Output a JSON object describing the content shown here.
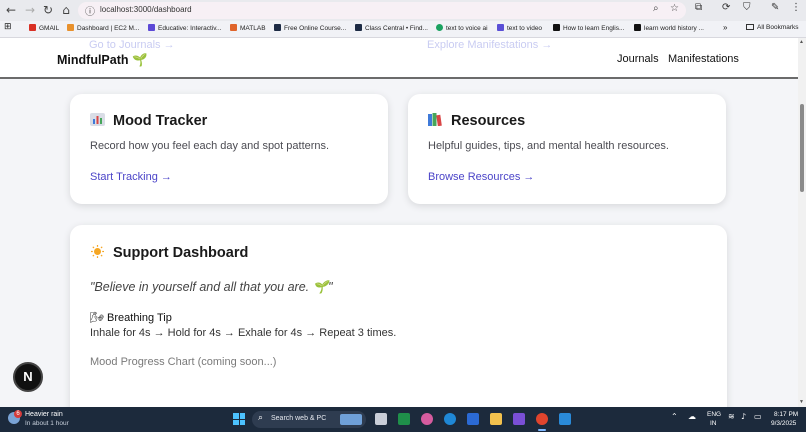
{
  "browser": {
    "url": "localhost:3000/dashboard",
    "bookmarks": [
      {
        "label": "GMAIL",
        "color": "#d93025"
      },
      {
        "label": "Dashboard | EC2 M...",
        "color": "#e8912d"
      },
      {
        "label": "Educative: Interactiv...",
        "color": "#5c49d6"
      },
      {
        "label": "MATLAB",
        "color": "#e0642a"
      },
      {
        "label": "Free Online Course...",
        "color": "#1d2b44"
      },
      {
        "label": "Class Central • Find...",
        "color": "#1d2b44"
      },
      {
        "label": "text to voice ai",
        "color": "#1aa260"
      },
      {
        "label": "text to video",
        "color": "#5a4fd6"
      },
      {
        "label": "How to learn Englis...",
        "color": "#111111"
      },
      {
        "label": "learn world history ...",
        "color": "#111111"
      }
    ],
    "all_bookmarks": "All Bookmarks"
  },
  "header": {
    "ghost_left": "Go to Journals →",
    "ghost_right": "Explore Manifestations →",
    "brand": "MindfulPath 🌱",
    "nav": [
      "Journals",
      "Manifestations"
    ]
  },
  "cards": {
    "mood": {
      "title": "Mood Tracker",
      "icon": "bar-chart-icon",
      "desc": "Record how you feel each day and spot patterns.",
      "link": "Start Tracking →"
    },
    "resources": {
      "title": "Resources",
      "icon": "books-icon",
      "desc": "Helpful guides, tips, and mental health resources.",
      "link": "Browse Resources →"
    }
  },
  "support": {
    "title": "Support Dashboard",
    "icon": "sun-icon",
    "quote": "\"Believe in yourself and all that you are. 🌱\"",
    "tip_title": "🌬 Breathing Tip",
    "tip_text": "Inhale for 4s → Hold for 4s → Exhale for 4s → Repeat 3 times.",
    "chart_note": "Mood Progress Chart (coming soon...)"
  },
  "dev_badge": "N",
  "taskbar": {
    "weather_title": "Heavier rain",
    "weather_sub": "In about 1 hour",
    "weather_badge": "6",
    "search": "Search web & PC",
    "lang_1": "ENG",
    "lang_2": "IN",
    "time": "8:17 PM",
    "date": "9/3/2025"
  },
  "colors": {
    "accent_link": "#4b44c8",
    "taskbar": "#1c2a3c"
  }
}
